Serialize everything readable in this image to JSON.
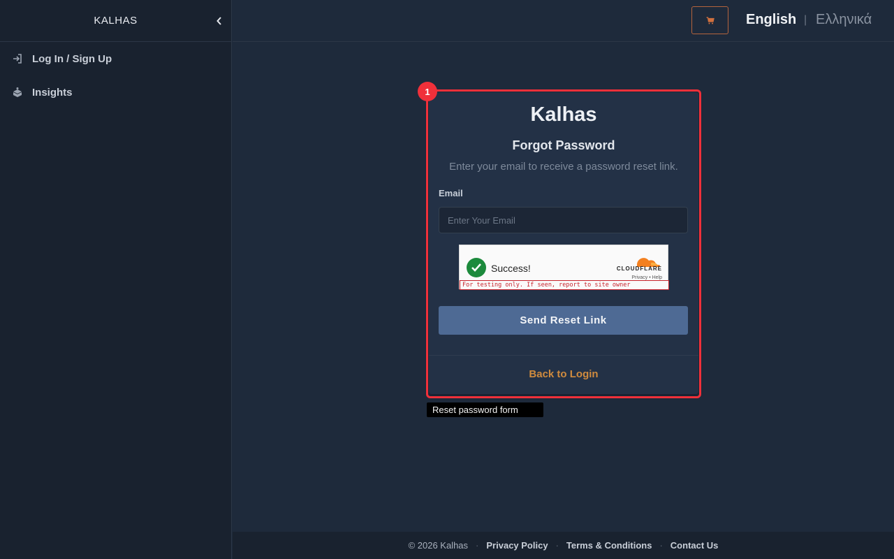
{
  "sidebar": {
    "brand": "KALHAS",
    "items": [
      {
        "label": "Log In / Sign Up",
        "icon": "login-icon"
      },
      {
        "label": "Insights",
        "icon": "insights-icon"
      }
    ]
  },
  "topbar": {
    "cart_icon": "cart-icon",
    "languages": {
      "english": "English",
      "separator": "|",
      "greek": "Ελληνικά"
    }
  },
  "card": {
    "title": "Kalhas",
    "subtitle": "Forgot Password",
    "description": "Enter your email to receive a password reset link.",
    "email_label": "Email",
    "email_placeholder": "Enter Your Email",
    "email_value": "",
    "captcha": {
      "status": "Success!",
      "provider": "CLOUDFLARE",
      "links": "Privacy • Help",
      "warning": "For testing only. If seen, report to site owner"
    },
    "submit_label": "Send Reset Link",
    "back_label": "Back to Login"
  },
  "annotation": {
    "badge": "1",
    "tooltip": "Reset password form"
  },
  "footer": {
    "copyright": "© 2026 Kalhas",
    "separator": "·",
    "links": [
      "Privacy Policy",
      "Terms & Conditions",
      "Contact Us"
    ]
  },
  "colors": {
    "accent": "#d08b3e",
    "primary_button": "#4e6a94",
    "highlight": "#f0303a",
    "background": "#1e2a3b",
    "sidebar": "#19222f"
  }
}
